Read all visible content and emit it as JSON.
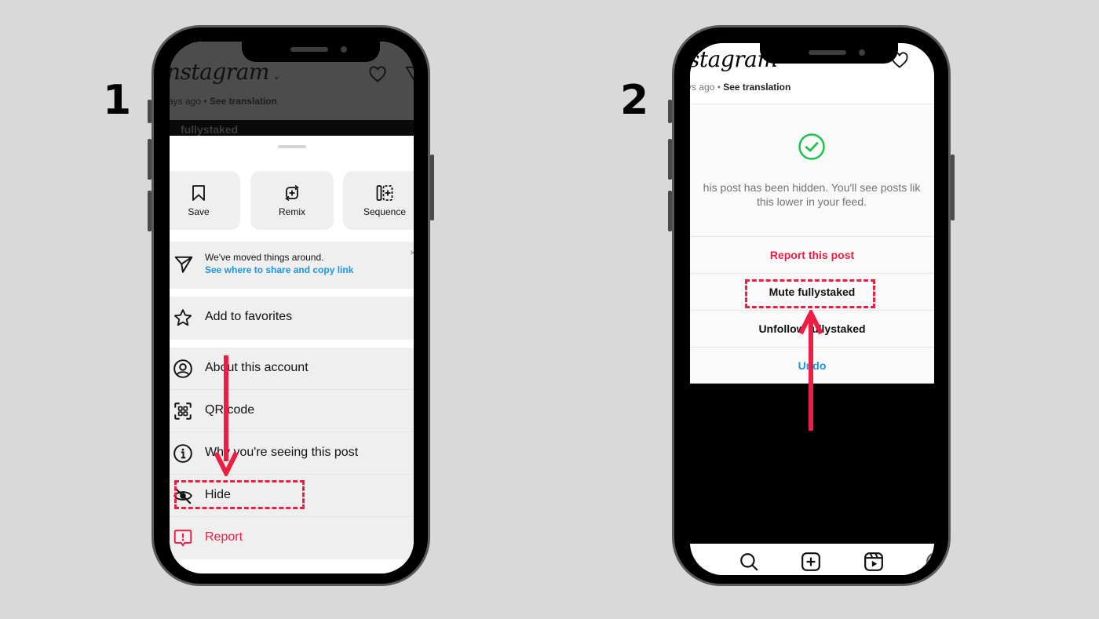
{
  "steps": [
    {
      "number": "1"
    },
    {
      "number": "2"
    }
  ],
  "step1": {
    "header": {
      "logo": "Instagram",
      "logo_visible": "nstagram",
      "meta_time": "ays ago",
      "meta_separator": "•",
      "meta_translate": "See translation",
      "post_username": "fullystaked"
    },
    "tiles": [
      {
        "label": "Save",
        "icon": "bookmark-icon"
      },
      {
        "label": "Remix",
        "icon": "remix-icon"
      },
      {
        "label": "Sequence",
        "icon": "sequence-icon"
      }
    ],
    "notice": {
      "line1": "We've moved things around.",
      "link": "See where to share and copy link",
      "close": "×"
    },
    "favorites": {
      "label": "Add to favorites",
      "icon": "star-icon"
    },
    "menu": [
      {
        "label": "About this account",
        "icon": "user-circle-icon"
      },
      {
        "label": "QR code",
        "icon": "qr-code-icon"
      },
      {
        "label": "Why you're seeing this post",
        "icon": "info-icon"
      },
      {
        "label": "Hide",
        "icon": "eye-off-icon"
      },
      {
        "label": "Report",
        "icon": "report-icon"
      }
    ],
    "highlighted_item": "Hide"
  },
  "step2": {
    "header": {
      "logo_visible": "stagram",
      "meta_time": "ys ago",
      "meta_separator": "•",
      "meta_translate": "See translation"
    },
    "hidden_message_line1": "his post has been hidden. You'll see posts lik",
    "hidden_message_line2": "this lower in your feed.",
    "actions": {
      "report": "Report this post",
      "mute": "Mute fullystaked",
      "unfollow": "Unfollow fullystaked",
      "undo": "Undo"
    },
    "highlighted_item": "Mute fullystaked",
    "tabbar": [
      "search-icon",
      "create-icon",
      "reels-icon"
    ]
  },
  "colors": {
    "annotation": "#ed1e44",
    "danger": "#ed1b46",
    "link": "#1b95e0",
    "success": "#1fc148",
    "background": "#d9d9d9"
  }
}
